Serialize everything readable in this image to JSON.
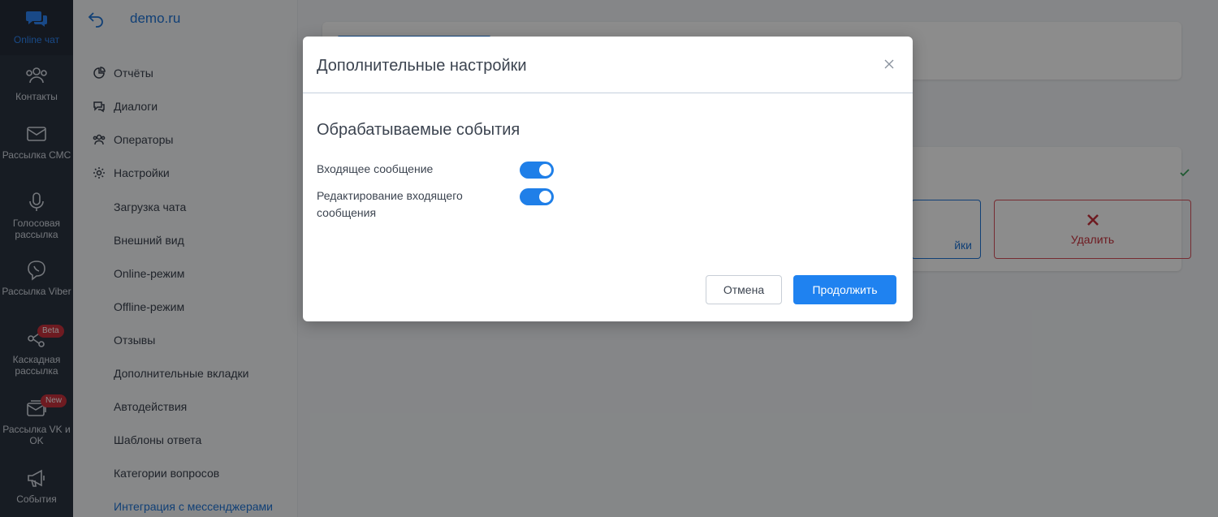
{
  "rail": {
    "items": [
      {
        "label": "Online чат"
      },
      {
        "label": "Контакты"
      },
      {
        "label": "Рассылка СМС"
      },
      {
        "label": "Голосовая рассылка"
      },
      {
        "label": "Рассылка Viber"
      },
      {
        "label": "Каскадная рассылка",
        "badge": "Beta"
      },
      {
        "label": "Рассылка VK и OK",
        "badge": "New"
      },
      {
        "label": "События"
      }
    ]
  },
  "sidebar": {
    "domain": "demo.ru",
    "items": [
      {
        "label": "Отчёты"
      },
      {
        "label": "Диалоги"
      },
      {
        "label": "Операторы"
      },
      {
        "label": "Настройки"
      }
    ],
    "subitems": [
      {
        "label": "Загрузка чата"
      },
      {
        "label": "Внешний вид"
      },
      {
        "label": "Online-режим"
      },
      {
        "label": "Offline-режим"
      },
      {
        "label": "Отзывы"
      },
      {
        "label": "Дополнительные вкладки"
      },
      {
        "label": "Автодействия"
      },
      {
        "label": "Шаблоны ответа"
      },
      {
        "label": "Категории вопросов"
      },
      {
        "label": "Интеграция с мессенджерами"
      }
    ]
  },
  "main": {
    "settings_button_partial": "йки",
    "delete_button": "Удалить"
  },
  "modal": {
    "title": "Дополнительные настройки",
    "section_title": "Обрабатываемые события",
    "options": [
      {
        "label": "Входящее сообщение",
        "enabled": true
      },
      {
        "label": "Редактирование входящего сообщения",
        "enabled": true
      }
    ],
    "cancel_label": "Отмена",
    "continue_label": "Продолжить"
  },
  "colors": {
    "accent": "#1f82f0",
    "rail_bg": "#2b3340",
    "danger": "#c8323d",
    "success": "#3aa35b"
  }
}
